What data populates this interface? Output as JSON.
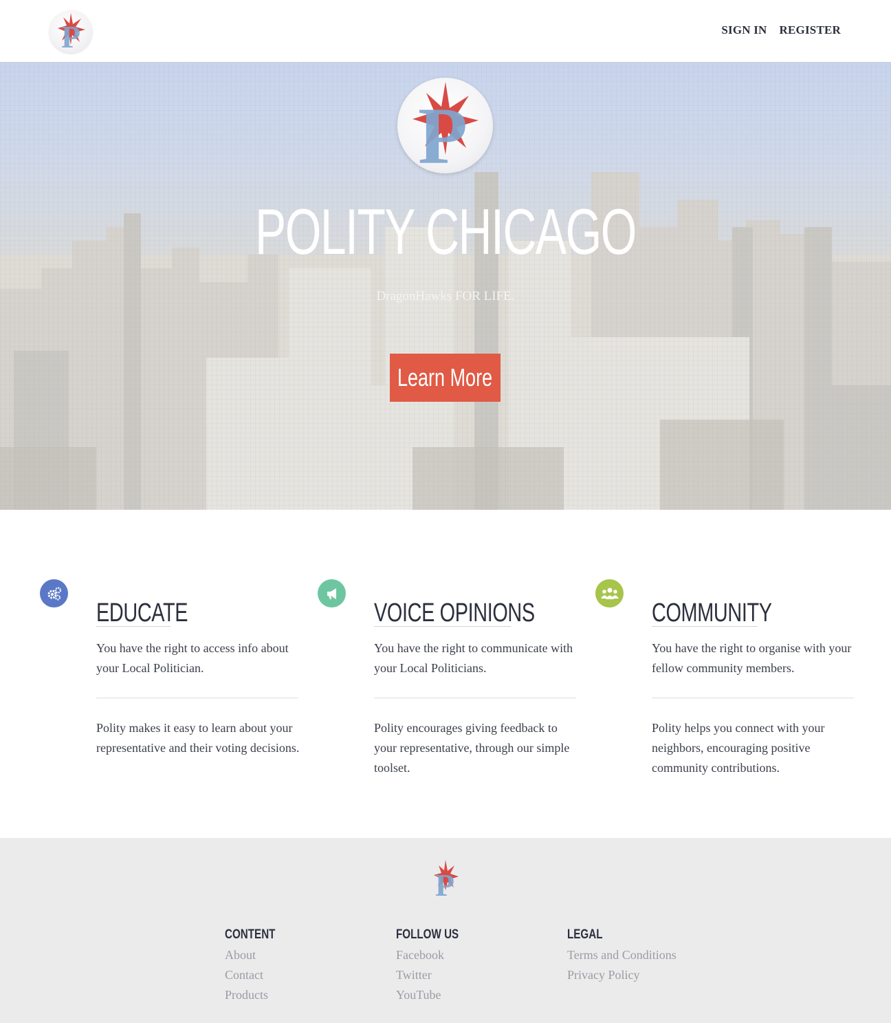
{
  "header": {
    "logo_icon": "polity-p-star-logo",
    "nav": [
      {
        "label": "SIGN IN"
      },
      {
        "label": "REGISTER"
      }
    ]
  },
  "hero": {
    "title": "POLITY CHICAGO",
    "subtitle": "DragonHawks FOR LIFE.",
    "button_label": "Learn More",
    "accent_color": "#e05a45"
  },
  "features": [
    {
      "icon": "gears-icon",
      "icon_color": "#5a78c6",
      "title": "EDUCATE",
      "text1": "You have the right to access info about your Local Politician.",
      "text2": "Polity makes it easy to learn about your representative and their voting decisions."
    },
    {
      "icon": "megaphone-icon",
      "icon_color": "#6ec6a1",
      "title": "VOICE OPINIONS",
      "text1": "You have the right to communicate with your Local Politicians.",
      "text2": "Polity encourages giving feedback to your representative, through our simple toolset."
    },
    {
      "icon": "users-icon",
      "icon_color": "#a7c44b",
      "title": "COMMUNITY",
      "text1": "You have the right to organise with your fellow community members.",
      "text2": "Polity helps you connect with your neighbors, encouraging positive community contributions."
    }
  ],
  "footer": {
    "columns": [
      {
        "heading": "CONTENT",
        "links": [
          "About",
          "Contact",
          "Products"
        ]
      },
      {
        "heading": "FOLLOW US",
        "links": [
          "Facebook",
          "Twitter",
          "YouTube"
        ]
      },
      {
        "heading": "LEGAL",
        "links": [
          "Terms and Conditions",
          "Privacy Policy"
        ]
      }
    ]
  }
}
